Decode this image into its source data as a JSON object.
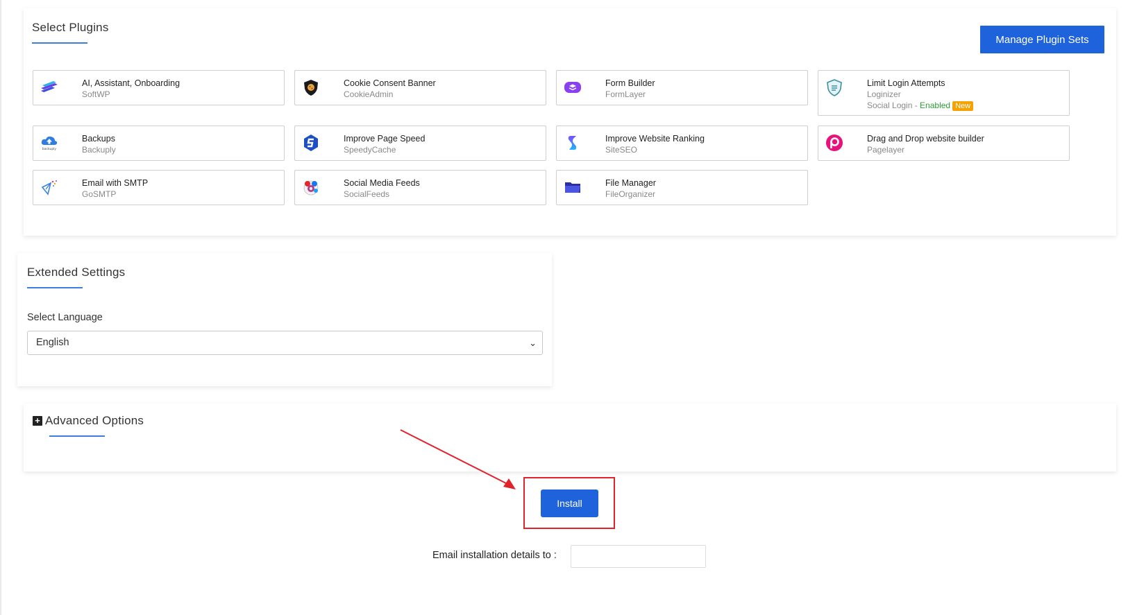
{
  "plugins": {
    "title": "Select Plugins",
    "manage_label": "Manage Plugin Sets",
    "items": [
      {
        "name": "AI, Assistant, Onboarding",
        "vendor": "SoftWP",
        "icon": "softwp-layers-icon"
      },
      {
        "name": "Cookie Consent Banner",
        "vendor": "CookieAdmin",
        "icon": "cookie-shield-icon"
      },
      {
        "name": "Form Builder",
        "vendor": "FormLayer",
        "icon": "formlayer-icon"
      },
      {
        "name": "Limit Login Attempts",
        "vendor": "Loginizer",
        "extra_prefix": "Social Login - ",
        "extra_status": "Enabled",
        "badge": "New",
        "icon": "loginizer-shield-icon"
      },
      {
        "name": "Backups",
        "vendor": "Backuply",
        "icon": "backup-cloud-icon"
      },
      {
        "name": "Improve Page Speed",
        "vendor": "SpeedyCache",
        "icon": "speedycache-icon"
      },
      {
        "name": "Improve Website Ranking",
        "vendor": "SiteSEO",
        "icon": "siteseo-icon"
      },
      {
        "name": "Drag and Drop website builder",
        "vendor": "Pagelayer",
        "icon": "pagelayer-icon"
      },
      {
        "name": "Email with SMTP",
        "vendor": "GoSMTP",
        "icon": "smtp-plane-icon"
      },
      {
        "name": "Social Media Feeds",
        "vendor": "SocialFeeds",
        "icon": "social-feeds-icon"
      },
      {
        "name": "File Manager",
        "vendor": "FileOrganizer",
        "icon": "folder-icon"
      }
    ]
  },
  "extended": {
    "title": "Extended Settings",
    "language_label": "Select Language",
    "language_value": "English"
  },
  "advanced": {
    "title": "Advanced Options"
  },
  "install": {
    "label": "Install",
    "email_label": "Email installation details to :",
    "email_value": ""
  },
  "colors": {
    "primary": "#1f63dc",
    "accent_underline": "#3b7ddd",
    "highlight_red": "#e0232b",
    "enabled_green": "#2e9c34",
    "badge_orange": "#f5a100"
  }
}
